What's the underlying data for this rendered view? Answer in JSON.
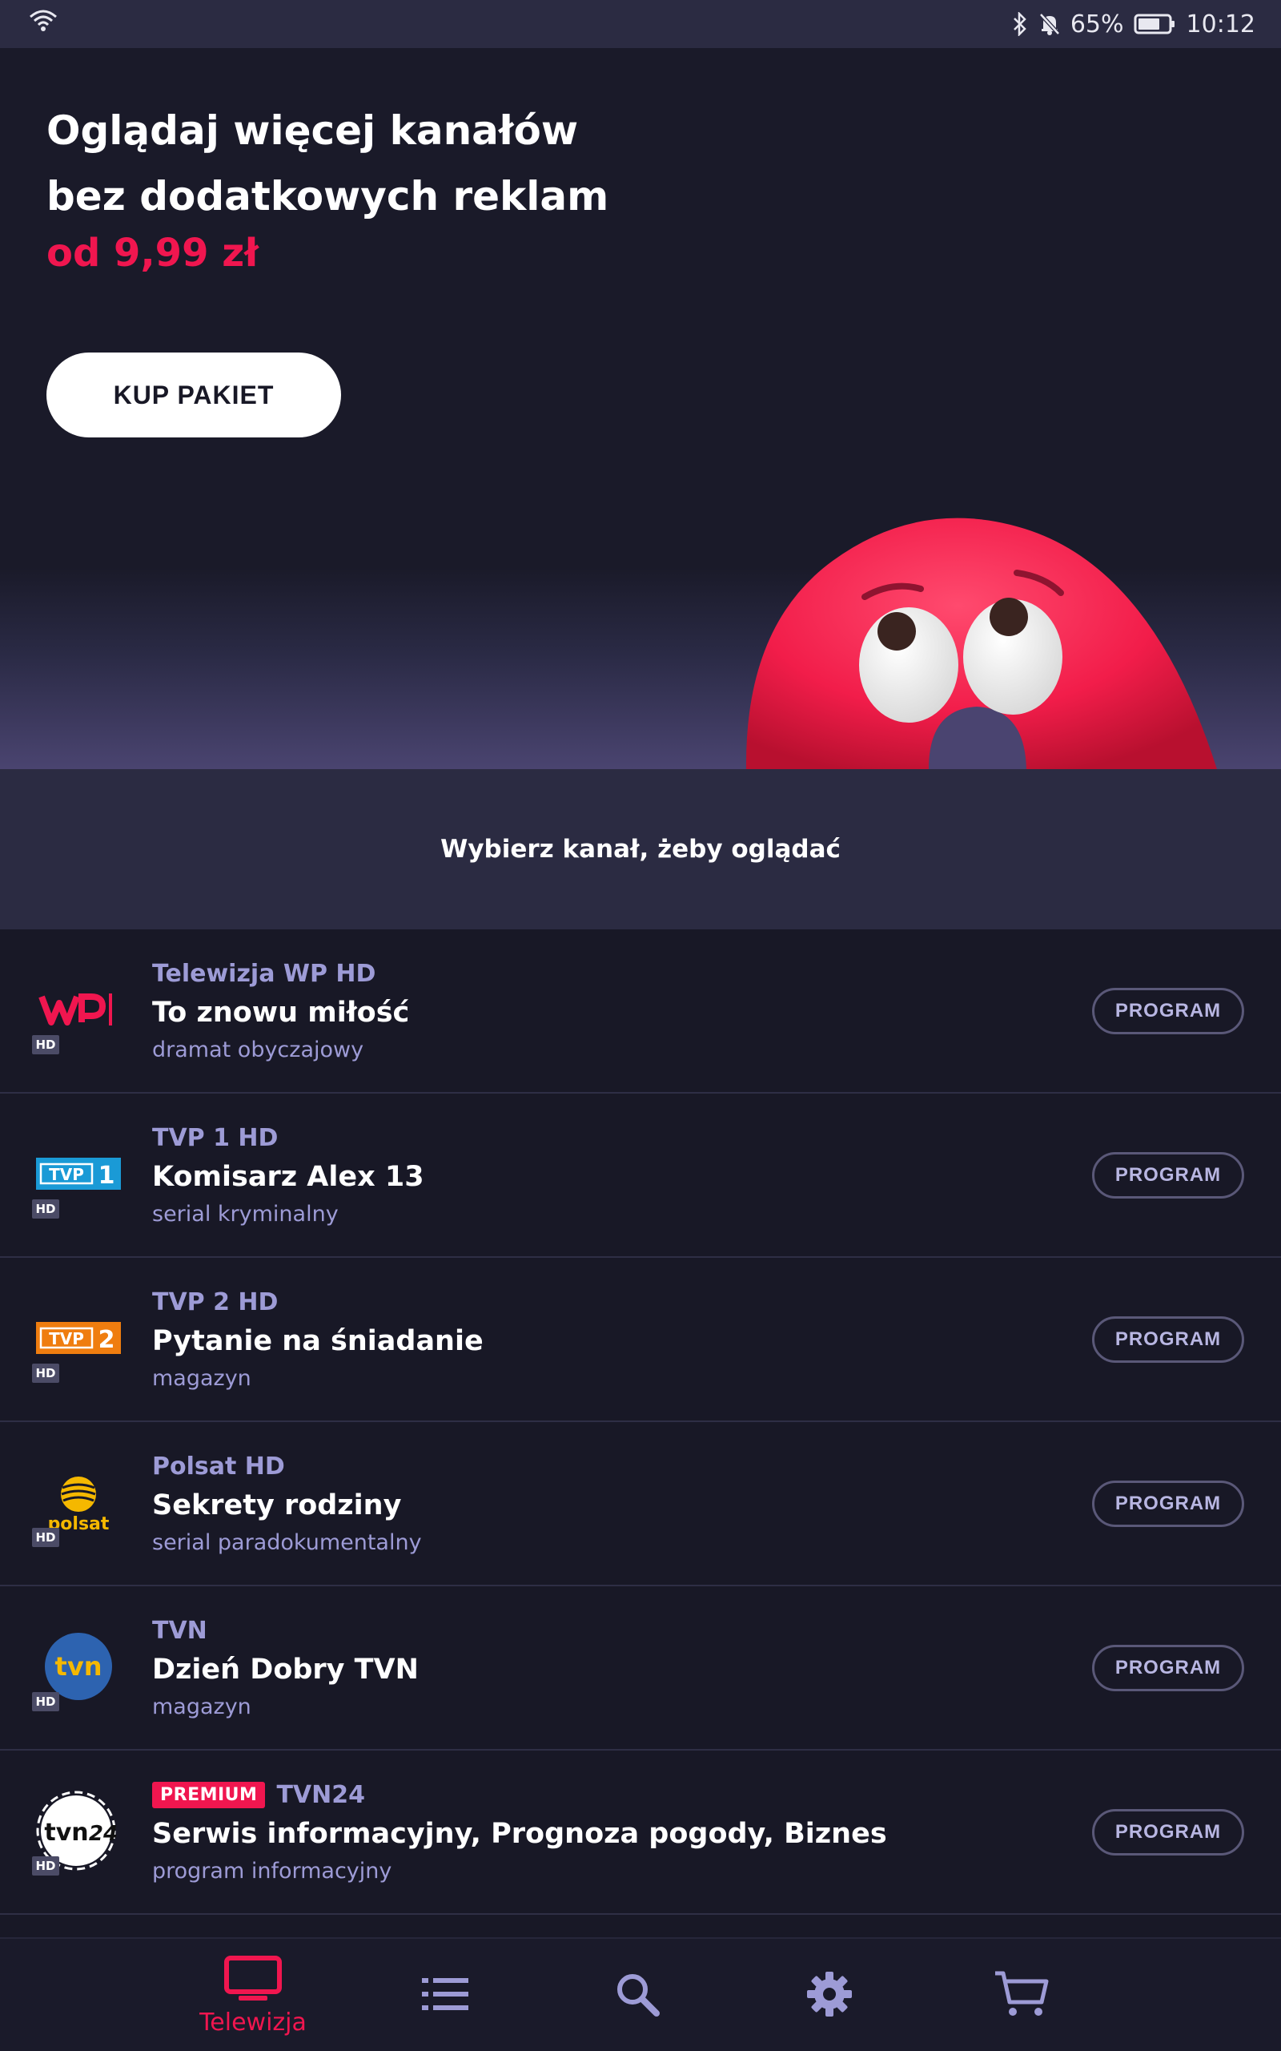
{
  "status_bar": {
    "battery": "65%",
    "time": "10:12"
  },
  "hero": {
    "title_line1": "Oglądaj więcej kanałów",
    "title_line2": "bez dodatkowych reklam",
    "price": "od 9,99 zł",
    "buy_label": "KUP PAKIET"
  },
  "choose_text": "Wybierz kanał, żeby oglądać",
  "hd_label": "HD",
  "program_label": "PROGRAM",
  "channels": [
    {
      "name": "Telewizja WP HD",
      "show": "To znowu miłość",
      "genre": "dramat obyczajowy",
      "premium": ""
    },
    {
      "name": "TVP 1 HD",
      "show": "Komisarz Alex 13",
      "genre": "serial kryminalny",
      "premium": ""
    },
    {
      "name": "TVP 2 HD",
      "show": "Pytanie na śniadanie",
      "genre": "magazyn",
      "premium": ""
    },
    {
      "name": "Polsat HD",
      "show": "Sekrety rodziny",
      "genre": "serial paradokumentalny",
      "premium": ""
    },
    {
      "name": "TVN",
      "show": "Dzień Dobry TVN",
      "genre": "magazyn",
      "premium": ""
    },
    {
      "name": "TVN24",
      "show": "Serwis informacyjny, Prognoza pogody, Biznes",
      "genre": "program informacyjny",
      "premium": "PREMIUM"
    }
  ],
  "logos": {
    "wp": "WP",
    "tvp1": "TVP1",
    "tvp2": "TVP2",
    "polsat": "polsat",
    "tvn": "tvn",
    "tvn24": "tvn24"
  },
  "nav": {
    "tv_label": "Telewizja",
    "active_color": "#f0164f",
    "inactive_color": "#9d9bd6"
  },
  "colors": {
    "accent": "#f0164f",
    "muted": "#9d9bd6",
    "background": "#181826"
  }
}
